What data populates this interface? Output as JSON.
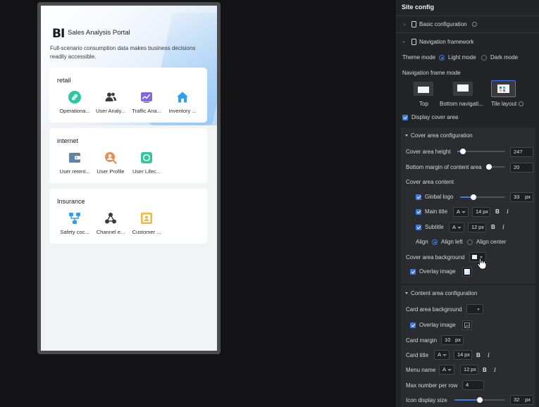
{
  "preview": {
    "logo": "BI",
    "main_title": "Sales Analysis Portal",
    "subtitle": "Full-scenario consumption data makes business decisions readily accessible.",
    "cards": [
      {
        "title": "retail",
        "menus": [
          {
            "name": "Operationa...",
            "icon": "link-icon",
            "color": "#2cc7a3"
          },
          {
            "name": "User Analy...",
            "icon": "users-icon",
            "color": "#3b3b3b"
          },
          {
            "name": "Traffic Ana...",
            "icon": "trend-chart-icon",
            "color": "#8167e6"
          },
          {
            "name": "Inventory ...",
            "icon": "home-icon",
            "color": "#2f9ff0"
          }
        ]
      },
      {
        "title": "internet",
        "menus": [
          {
            "name": "User retent...",
            "icon": "wallet-icon",
            "color": "#5f85a3"
          },
          {
            "name": "User Profile",
            "icon": "user-search-icon",
            "color": "#ec8c55"
          },
          {
            "name": "User Lifec...",
            "icon": "lifecycle-icon",
            "color": "#35c6a0"
          }
        ]
      },
      {
        "title": "Insurance",
        "menus": [
          {
            "name": "Safety coc...",
            "icon": "hierarchy-icon",
            "color": "#2f9ff0"
          },
          {
            "name": "Channel e...",
            "icon": "network-icon",
            "color": "#3b3b3b"
          },
          {
            "name": "Customer ...",
            "icon": "contact-card-icon",
            "color": "#f3b73a"
          }
        ]
      }
    ]
  },
  "panel": {
    "title": "Site config",
    "basic_configuration": "Basic configuration",
    "navigation_framework": "Navigation framework",
    "theme_mode_label": "Theme mode",
    "theme_light": "Light mode",
    "theme_dark": "Dark mode",
    "theme_selected": "Light mode",
    "nav_frame_mode_label": "Navigation frame mode",
    "nav_modes": [
      "Top",
      "Bottom navigati...",
      "Tile layout"
    ],
    "nav_mode_selected": "Tile layout",
    "display_cover_area": "Display cover area",
    "cover_section": {
      "title": "Cover area configuration",
      "height_label": "Cover area height",
      "height_value": "247",
      "height_fraction": 0.12,
      "bottom_margin_label": "Bottom margin of content area",
      "bottom_margin_value": "20",
      "bottom_margin_fraction": 0.1,
      "content_label": "Cover area content",
      "global_logo_label": "Global logo",
      "global_logo_value": "33",
      "global_logo_fraction": 0.3,
      "main_title_label": "Main title",
      "main_title_font": "A",
      "main_title_size": "14",
      "subtitle_label": "Subtitle",
      "subtitle_font": "A",
      "subtitle_size": "12",
      "px": "px",
      "bold": "B",
      "italic": "I",
      "align_label": "Align",
      "align_left": "Align left",
      "align_center": "Align center",
      "align_selected": "Align left",
      "background_label": "Cover area background",
      "overlay_image_label": "Overlay image"
    },
    "content_section": {
      "title": "Content area configuration",
      "card_bg_label": "Card area background",
      "overlay_image_label": "Overlay image",
      "card_margin_label": "Card margin",
      "card_margin_value": "10",
      "card_title_label": "Card title",
      "card_title_font": "A",
      "card_title_size": "14",
      "menu_name_label": "Menu name",
      "menu_name_font": "A",
      "menu_name_size": "12",
      "max_per_row_label": "Max number per row",
      "max_per_row_value": "4",
      "icon_size_label": "Icon display size",
      "icon_size_value": "32",
      "icon_size_fraction": 0.5,
      "px": "px",
      "bold": "B",
      "italic": "I"
    }
  }
}
